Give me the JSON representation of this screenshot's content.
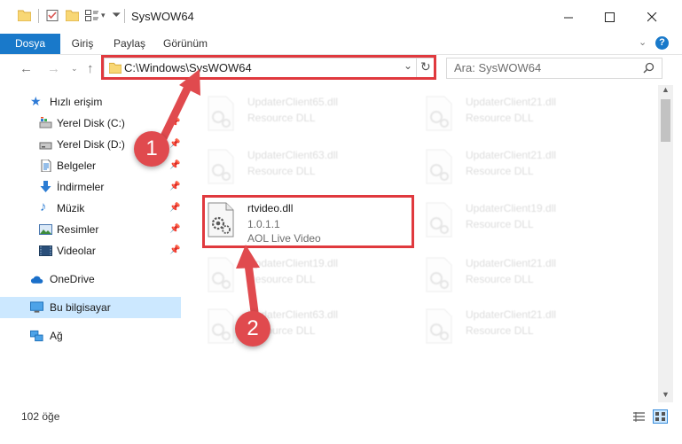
{
  "window": {
    "title": "SysWOW64"
  },
  "ribbon": {
    "tabs": [
      {
        "label": "Dosya"
      },
      {
        "label": "Giriş"
      },
      {
        "label": "Paylaş"
      },
      {
        "label": "Görünüm"
      }
    ]
  },
  "address": {
    "path": "C:\\Windows\\SysWOW64"
  },
  "search": {
    "placeholder": "Ara: SysWOW64"
  },
  "sidebar": {
    "quick_access": "Hızlı erişim",
    "items": [
      {
        "label": "Yerel Disk (C:)"
      },
      {
        "label": "Yerel Disk (D:)"
      },
      {
        "label": "Belgeler"
      },
      {
        "label": "İndirmeler"
      },
      {
        "label": "Müzik"
      },
      {
        "label": "Resimler"
      },
      {
        "label": "Videolar"
      }
    ],
    "onedrive": "OneDrive",
    "this_pc": "Bu bilgisayar",
    "network": "Ağ"
  },
  "files": {
    "focus": {
      "name": "rtvideo.dll",
      "version": "1.0.1.1",
      "description": "AOL Live Video"
    },
    "left": [
      {
        "name": "UpdaterClient65.dll",
        "type": "Resource DLL"
      },
      {
        "name": "UpdaterClient63.dll",
        "type": "Resource DLL"
      },
      {
        "name": "UpdaterClient19.dll",
        "type": "Resource DLL"
      },
      {
        "name": "UpdaterClient63.dll",
        "type": "Resource DLL"
      }
    ],
    "right": [
      {
        "name": "UpdaterClient21.dll",
        "type": "Resource DLL"
      },
      {
        "name": "UpdaterClient21.dll",
        "type": "Resource DLL"
      },
      {
        "name": "UpdaterClient19.dll",
        "type": "Resource DLL"
      },
      {
        "name": "UpdaterClient21.dll",
        "type": "Resource DLL"
      },
      {
        "name": "UpdaterClient21.dll",
        "type": "Resource DLL"
      }
    ]
  },
  "annotations": {
    "step1": "1",
    "step2": "2"
  },
  "status": {
    "count": "102 öğe"
  },
  "colors": {
    "accent": "#1979ca",
    "highlight": "#e0393e",
    "selected": "#cce8ff"
  }
}
